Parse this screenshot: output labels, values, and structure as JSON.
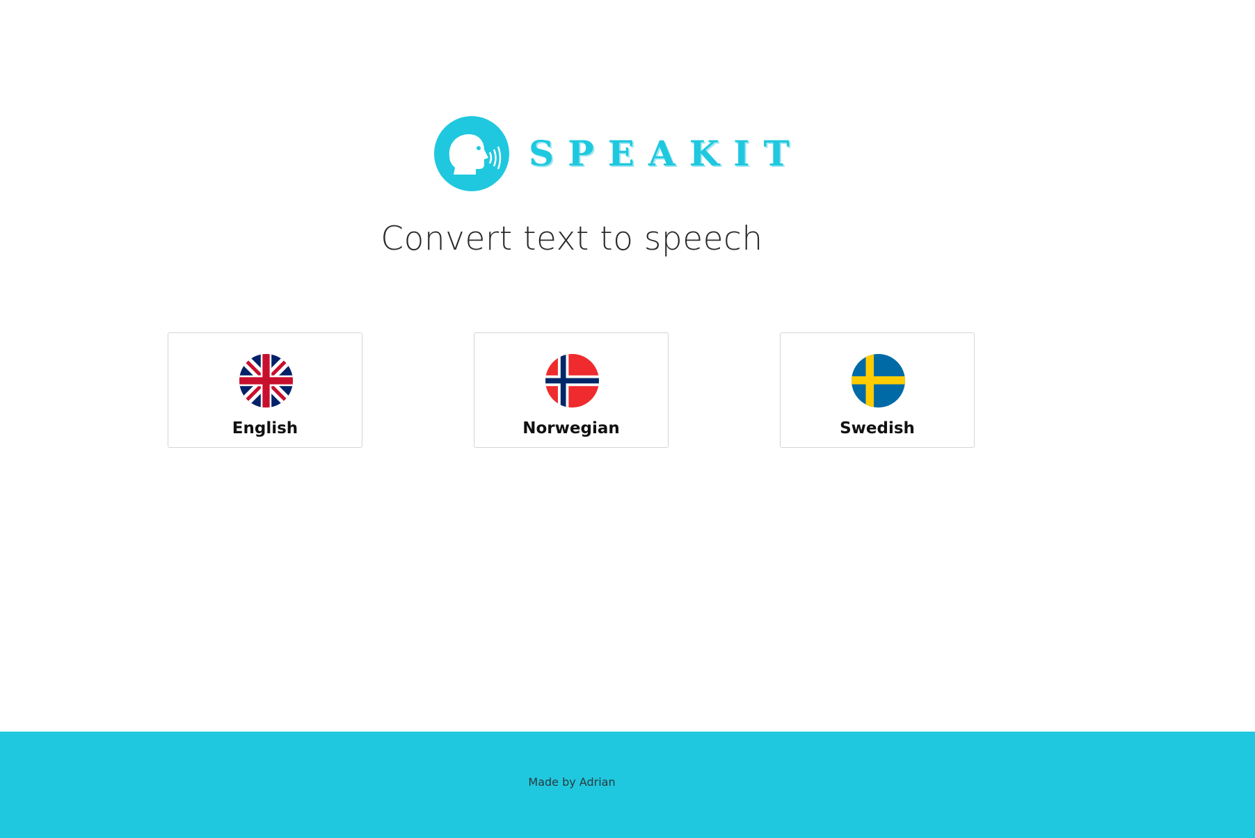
{
  "brand": {
    "name": "SPEAKIT",
    "logo_icon": "speaking-head-icon",
    "accent_color": "#1fc8df"
  },
  "tagline": "Convert text to speech",
  "languages": [
    {
      "label": "English",
      "flag_icon": "uk-flag-icon"
    },
    {
      "label": "Norwegian",
      "flag_icon": "norway-flag-icon"
    },
    {
      "label": "Swedish",
      "flag_icon": "sweden-flag-icon"
    }
  ],
  "footer": {
    "text": "Made by Adrian",
    "background_color": "#1fc8df"
  }
}
